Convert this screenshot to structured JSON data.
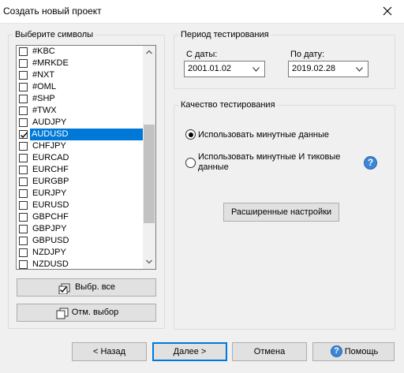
{
  "window": {
    "title": "Создать новый проект"
  },
  "symbols": {
    "legend": "Выберите символы",
    "items": [
      {
        "label": "#KBC",
        "checked": false
      },
      {
        "label": "#MRKDE",
        "checked": false
      },
      {
        "label": "#NXT",
        "checked": false
      },
      {
        "label": "#OML",
        "checked": false
      },
      {
        "label": "#SHP",
        "checked": false
      },
      {
        "label": "#TWX",
        "checked": false
      },
      {
        "label": "AUDJPY",
        "checked": false
      },
      {
        "label": "AUDUSD",
        "checked": true,
        "selected": true
      },
      {
        "label": "CHFJPY",
        "checked": false
      },
      {
        "label": "EURCAD",
        "checked": false
      },
      {
        "label": "EURCHF",
        "checked": false
      },
      {
        "label": "EURGBP",
        "checked": false
      },
      {
        "label": "EURJPY",
        "checked": false
      },
      {
        "label": "EURUSD",
        "checked": false
      },
      {
        "label": "GBPCHF",
        "checked": false
      },
      {
        "label": "GBPJPY",
        "checked": false
      },
      {
        "label": "GBPUSD",
        "checked": false
      },
      {
        "label": "NZDJPY",
        "checked": false
      },
      {
        "label": "NZDUSD",
        "checked": false
      }
    ],
    "select_all": "Выбр. все",
    "deselect": "Отм. выбор"
  },
  "period": {
    "legend": "Период тестирования",
    "from_label": "С даты:",
    "from_value": "2001.01.02",
    "to_label": "По дату:",
    "to_value": "2019.02.28"
  },
  "quality": {
    "legend": "Качество тестирования",
    "option1": "Использовать минутные данные",
    "option2_line1": "Использовать минутные И тиковые",
    "option2_line2": "данные",
    "selected_option": 1,
    "advanced_button": "Расширенные настройки",
    "help_glyph": "?"
  },
  "footer": {
    "back": "< Назад",
    "next": "Далее >",
    "cancel": "Отмена",
    "help": "Помощь"
  },
  "colors": {
    "accent": "#0078d7",
    "help_icon": "#3b86d6"
  }
}
